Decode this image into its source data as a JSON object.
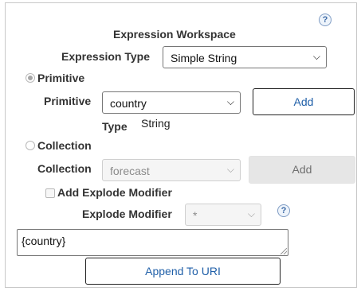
{
  "header": {
    "title": "Expression Workspace",
    "help_glyph": "?"
  },
  "expression_type": {
    "label": "Expression Type",
    "selected": "Simple String"
  },
  "primitive": {
    "radio_label": "Primitive",
    "selected": true,
    "field_label": "Primitive",
    "field_value": "country",
    "add_label": "Add",
    "type_label": "Type",
    "type_value": "String"
  },
  "collection": {
    "radio_label": "Collection",
    "selected": false,
    "field_label": "Collection",
    "field_value": "forecast",
    "add_label": "Add"
  },
  "explode": {
    "checkbox_label": "Add Explode Modifier",
    "checked": false,
    "field_label": "Explode Modifier",
    "field_value": "*",
    "help_glyph": "?"
  },
  "expression": {
    "value": "{country}"
  },
  "actions": {
    "append_label": "Append To URI"
  },
  "icons": {
    "help": "help-icon",
    "chevron": "chevron-down-icon",
    "resize": "resize-grip-icon"
  }
}
